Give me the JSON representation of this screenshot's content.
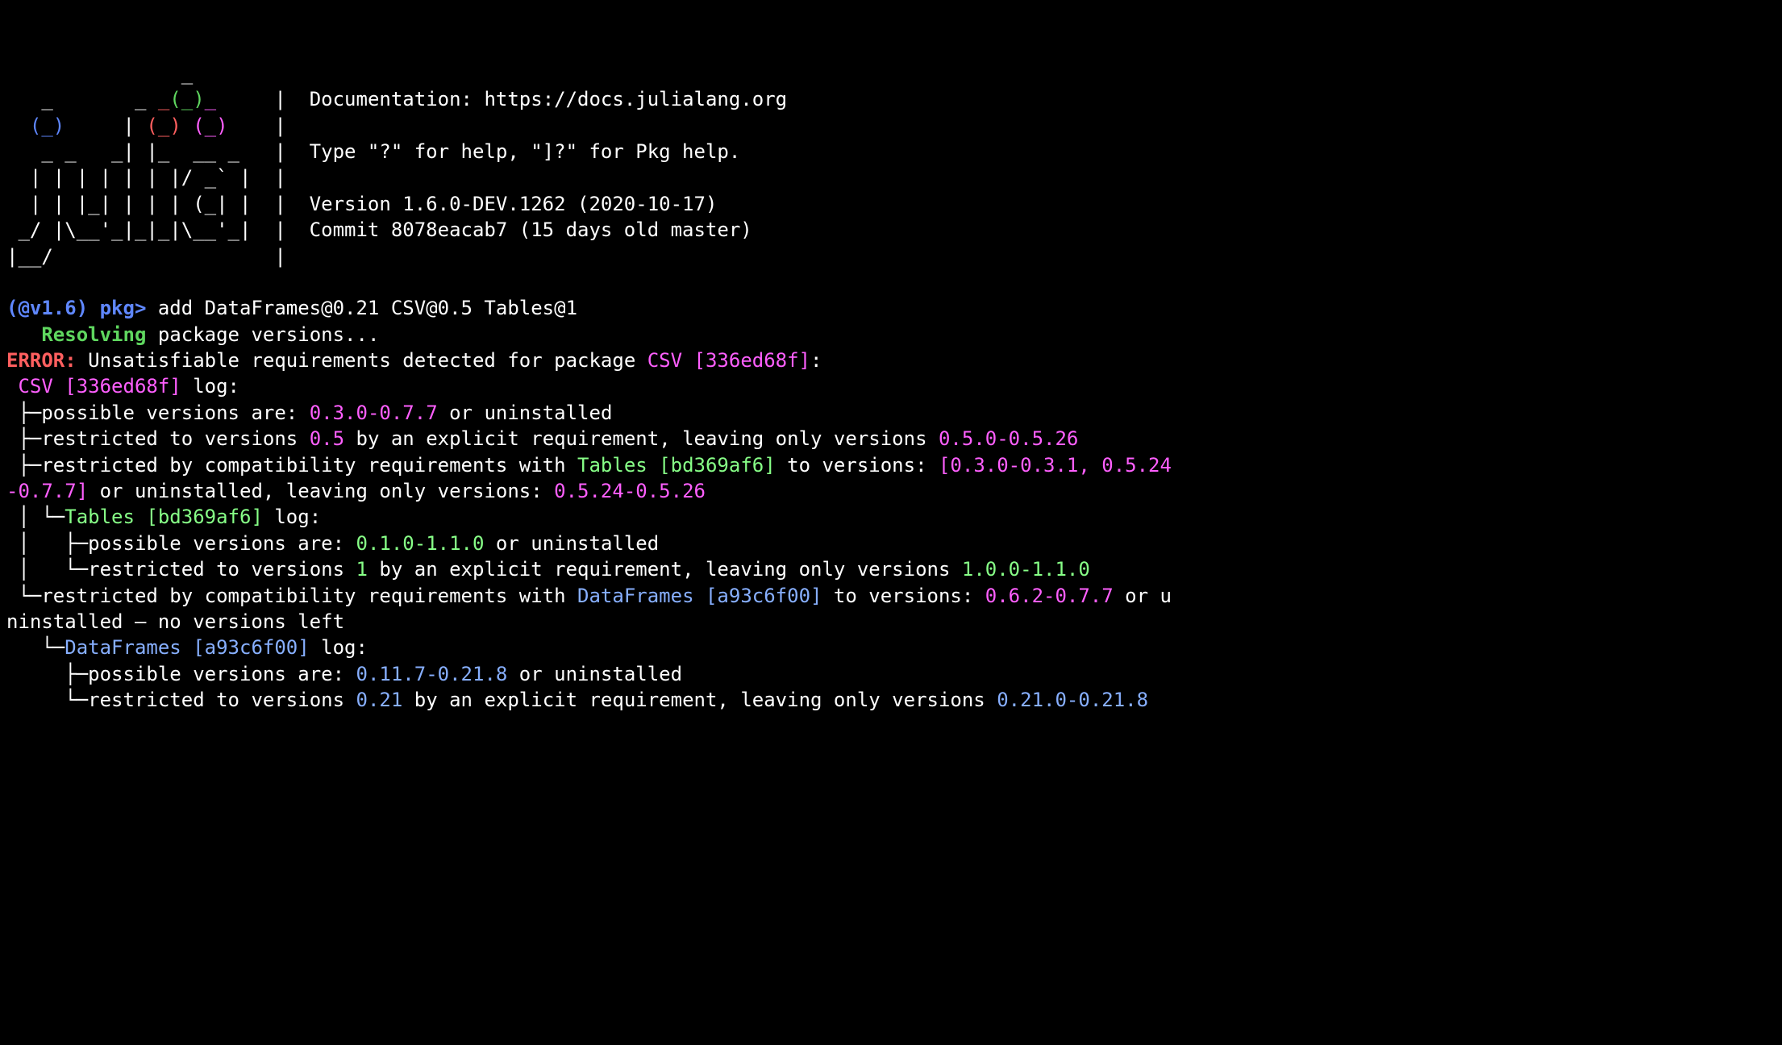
{
  "banner": {
    "l1": "               _",
    "l2p1": "   _       _ ",
    "l2c1": "_",
    "l2c2": "(_)",
    "l2c3": "_",
    "l2p2": "     |  Documentation: https://docs.julialang.org",
    "l3p1": "  ",
    "l3c1": "(_)",
    "l3p2": "     | ",
    "l3c2": "(_)",
    "l3p3": " ",
    "l3c3": "(_)",
    "l3p4": "    |",
    "l4": "   _ _   _| |_  __ _   |  Type \"?\" for help, \"]?\" for Pkg help.",
    "l5": "  | | | | | | |/ _` |  |",
    "l6": "  | | |_| | | | (_| |  |  Version 1.6.0-DEV.1262 (2020-10-17)",
    "l7": " _/ |\\__'_|_|_|\\__'_|  |  Commit 8078eacab7 (15 days old master)",
    "l8": "|__/                   |"
  },
  "prompt": {
    "env": "(@v1.6) pkg>",
    "cmd": " add DataFrames@0.21 CSV@0.5 Tables@1"
  },
  "resolving": {
    "pad": "   ",
    "label": "Resolving",
    "rest": " package versions..."
  },
  "error": {
    "label": "ERROR:",
    "pre": " Unsatisfiable requirements detected for package ",
    "pkg": "CSV [336ed68f]",
    "post": ":"
  },
  "csv_log": {
    "indent": " ",
    "pkg": "CSV [336ed68f]",
    "rest": " log:"
  },
  "csv1": {
    "tree": " ├─",
    "pre": "possible versions are: ",
    "ver": "0.3.0-0.7.7",
    "post": " or uninstalled"
  },
  "csv2": {
    "tree": " ├─",
    "pre": "restricted to versions ",
    "ver1": "0.5",
    "mid": " by an explicit requirement, leaving only versions ",
    "ver2": "0.5.0-0.5.26"
  },
  "csv3": {
    "tree": " ├─",
    "pre": "restricted by compatibility requirements with ",
    "pkg": "Tables [bd369af6]",
    "mid": " to versions: ",
    "ver1a": "[0.3.0-0.3.1, 0.5.24",
    "ver1b": "-0.7.7]",
    "mid2": " or uninstalled, leaving only versions: ",
    "ver2": "0.5.24-0.5.26"
  },
  "tables_log": {
    "tree": " │ └─",
    "pkg": "Tables [bd369af6]",
    "rest": " log:"
  },
  "tables1": {
    "tree": " │   ├─",
    "pre": "possible versions are: ",
    "ver": "0.1.0-1.1.0",
    "post": " or uninstalled"
  },
  "tables2": {
    "tree": " │   └─",
    "pre": "restricted to versions ",
    "ver1": "1",
    "mid": " by an explicit requirement, leaving only versions ",
    "ver2": "1.0.0-1.1.0"
  },
  "csv4": {
    "tree": " └─",
    "pre": "restricted by compatibility requirements with ",
    "pkg": "DataFrames [a93c6f00]",
    "mid": " to versions: ",
    "ver": "0.6.2-0.7.7",
    "post1": " or u",
    "post2": "ninstalled — no versions left"
  },
  "df_log": {
    "tree": "   └─",
    "pkg": "DataFrames [a93c6f00]",
    "rest": " log:"
  },
  "df1": {
    "tree": "     ├─",
    "pre": "possible versions are: ",
    "ver": "0.11.7-0.21.8",
    "post": " or uninstalled"
  },
  "df2": {
    "tree": "     └─",
    "pre": "restricted to versions ",
    "ver1": "0.21",
    "mid": " by an explicit requirement, leaving only versions ",
    "ver2": "0.21.0-0.21.8"
  }
}
